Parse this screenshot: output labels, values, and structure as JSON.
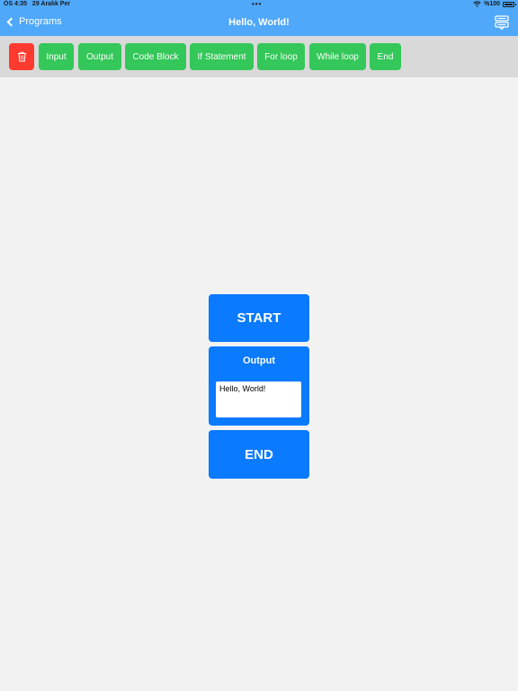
{
  "status_bar": {
    "time": "ÖS 4:35",
    "date": "29 Aralık Per",
    "dots": "•••",
    "battery": "%100"
  },
  "nav": {
    "back_label": "Programs",
    "title": "Hello, World!",
    "action_icon": "flowchart-icon"
  },
  "toolbar": {
    "delete_icon": "trash-icon",
    "buttons": [
      {
        "label": "Input"
      },
      {
        "label": "Output"
      },
      {
        "label": "Code Block"
      },
      {
        "label": "If Statement"
      },
      {
        "label": "For loop"
      },
      {
        "label": "While loop"
      },
      {
        "label": "End"
      }
    ]
  },
  "flow": {
    "start_label": "START",
    "output_title": "Output",
    "output_value": "Hello, World!",
    "end_label": "END"
  },
  "colors": {
    "nav_background": "#4fa8f9",
    "toolbar_background": "#d9d9d9",
    "add_button": "#34c759",
    "delete_button": "#ff3b30",
    "flow_block": "#0a7aff",
    "canvas_background": "#f2f2f2"
  }
}
